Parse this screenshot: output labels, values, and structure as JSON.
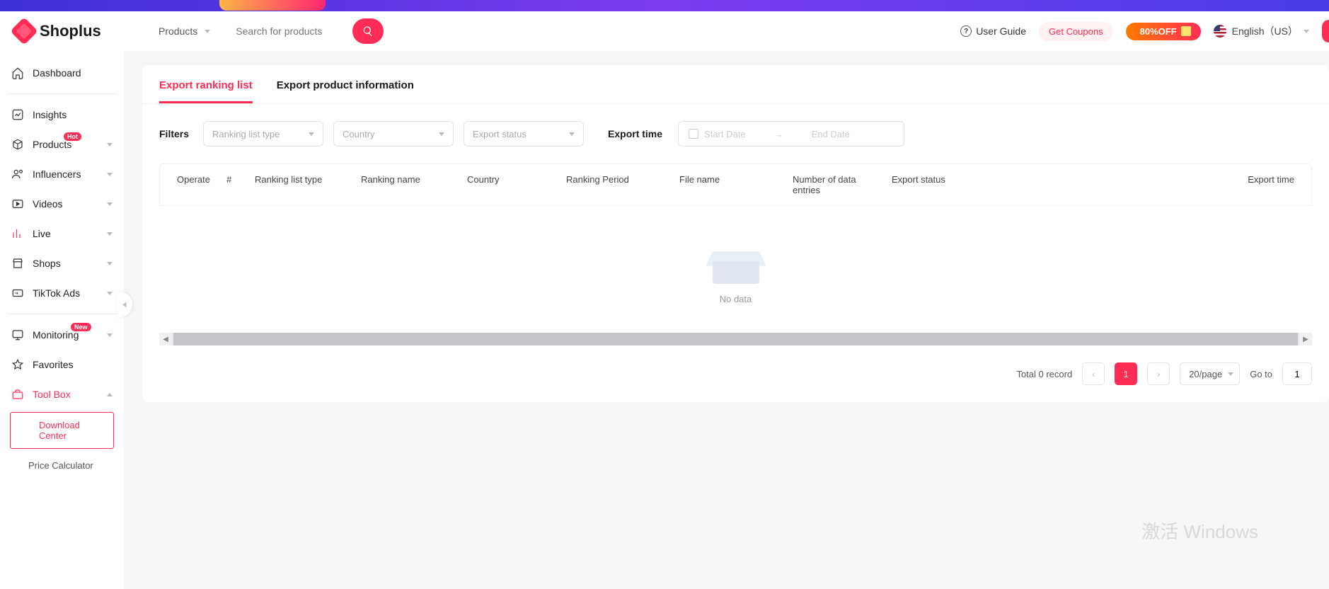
{
  "header": {
    "brand": "Shoplus",
    "category_selected": "Products",
    "search_placeholder": "Search for products",
    "user_guide": "User Guide",
    "get_coupons": "Get Coupons",
    "promo": "80%OFF",
    "language": "English（US）"
  },
  "sidebar": {
    "dashboard": "Dashboard",
    "insights": "Insights",
    "products": "Products",
    "products_badge": "Hot",
    "influencers": "Influencers",
    "videos": "Videos",
    "live": "Live",
    "shops": "Shops",
    "tiktok_ads": "TikTok Ads",
    "monitoring": "Monitoring",
    "monitoring_badge": "New",
    "favorites": "Favorites",
    "toolbox": "Tool Box",
    "download_center": "Download Center",
    "price_calculator": "Price Calculator"
  },
  "tabs": {
    "export_ranking": "Export ranking list",
    "export_product": "Export product information"
  },
  "filters": {
    "label": "Filters",
    "ranking_type": "Ranking list type",
    "country": "Country",
    "export_status": "Export status",
    "export_time_label": "Export time",
    "start_date": "Start Date",
    "end_date": "End Date"
  },
  "table": {
    "operate": "Operate",
    "num": "#",
    "type": "Ranking list type",
    "name": "Ranking name",
    "country": "Country",
    "period": "Ranking Period",
    "file": "File name",
    "entries": "Number of data entries",
    "status": "Export status",
    "etime": "Export time",
    "empty": "No data"
  },
  "pagination": {
    "total": "Total 0 record",
    "current": "1",
    "per_page": "20/page",
    "goto": "Go to",
    "goto_value": "1"
  },
  "watermark": "激活 Windows"
}
